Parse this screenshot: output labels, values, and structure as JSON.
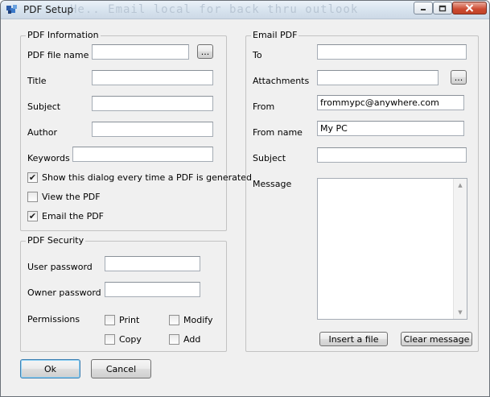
{
  "window": {
    "title": "PDF Setup",
    "background_text": "He.. Email local for back thru outlook",
    "icons": {
      "app": "pdf-setup-app-icon",
      "minimize": "minimize-icon",
      "maximize": "maximize-icon",
      "close": "close-icon"
    }
  },
  "pdf_info": {
    "legend": "PDF Information",
    "file_name": {
      "label": "PDF file name",
      "value": "",
      "browse": "..."
    },
    "title": {
      "label": "Title",
      "value": ""
    },
    "subject": {
      "label": "Subject",
      "value": ""
    },
    "author": {
      "label": "Author",
      "value": ""
    },
    "keywords": {
      "label": "Keywords",
      "value": ""
    },
    "show_dialog": {
      "label": "Show this dialog every time a PDF is generated",
      "checked": true,
      "mark": "✔"
    },
    "view_pdf": {
      "label": "View the PDF",
      "checked": false,
      "mark": ""
    },
    "email_pdf": {
      "label": "Email the PDF",
      "checked": true,
      "mark": "✔"
    }
  },
  "pdf_security": {
    "legend": "PDF Security",
    "user_password": {
      "label": "User password",
      "value": ""
    },
    "owner_password": {
      "label": "Owner password",
      "value": ""
    },
    "permissions_label": "Permissions",
    "print": {
      "label": "Print",
      "checked": false,
      "mark": ""
    },
    "modify": {
      "label": "Modify",
      "checked": false,
      "mark": ""
    },
    "copy": {
      "label": "Copy",
      "checked": false,
      "mark": ""
    },
    "add": {
      "label": "Add",
      "checked": false,
      "mark": ""
    }
  },
  "email_pdf": {
    "legend": "Email PDF",
    "to": {
      "label": "To",
      "value": ""
    },
    "attachments": {
      "label": "Attachments",
      "value": "",
      "browse": "..."
    },
    "from": {
      "label": "From",
      "value": "frommypc@anywhere.com"
    },
    "from_name": {
      "label": "From name",
      "value": "My PC"
    },
    "subject": {
      "label": "Subject",
      "value": ""
    },
    "message": {
      "label": "Message",
      "value": ""
    },
    "insert_file": "Insert a file",
    "clear_message": "Clear message"
  },
  "footer": {
    "ok": "Ok",
    "cancel": "Cancel"
  }
}
